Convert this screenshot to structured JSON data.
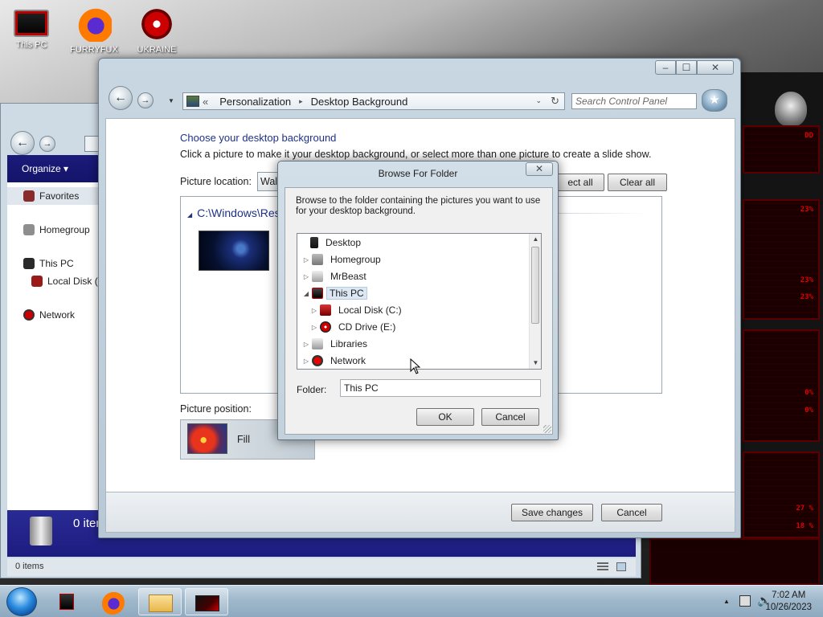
{
  "desktop_icons": [
    {
      "label": "This PC",
      "icon": "this-pc-icon"
    },
    {
      "label": "FURRYFUX",
      "icon": "firefox-icon"
    },
    {
      "label": "UKRAINE",
      "icon": "radiation-icon"
    }
  ],
  "explorer": {
    "organize_label": "Organize ▾",
    "sidebar": [
      {
        "label": "Favorites",
        "icon": "star-icon"
      },
      {
        "label": "Homegroup",
        "icon": "homegroup-icon"
      },
      {
        "label": "This PC",
        "icon": "computer-icon"
      },
      {
        "label": "Local Disk (C:",
        "icon": "disk-icon"
      },
      {
        "label": "Network",
        "icon": "network-icon"
      }
    ],
    "footer_text": "0 iten",
    "status_text": "0 items"
  },
  "control_panel": {
    "breadcrumb": [
      "Personalization",
      "Desktop Background"
    ],
    "breadcrumb_prefix": "«",
    "search_placeholder": "Search Control Panel",
    "heading": "Choose your desktop background",
    "instruction": "Click a picture to make it your desktop background, or select more than one picture to create a slide show.",
    "picture_location_label": "Picture location:",
    "picture_location_value": "Wall",
    "select_all_label": "ect all",
    "clear_all_label": "Clear all",
    "gallery_group": "C:\\Windows\\Res",
    "picture_position_label": "Picture position:",
    "picture_position_value": "Fill",
    "save_label": "Save changes",
    "cancel_label": "Cancel",
    "min_glyph": "‒",
    "max_glyph": "☐",
    "close_glyph": "✕"
  },
  "browse_dialog": {
    "title": "Browse For Folder",
    "close_glyph": "✕",
    "description": "Browse to the folder containing the pictures you want to use for your desktop background.",
    "tree": [
      {
        "label": "Desktop",
        "icon": "desktop-icon",
        "level": 0,
        "expander": "",
        "selected": false
      },
      {
        "label": "Homegroup",
        "icon": "homegroup-icon",
        "level": 1,
        "expander": "▷",
        "selected": false
      },
      {
        "label": "MrBeast",
        "icon": "user-folder-icon",
        "level": 1,
        "expander": "▷",
        "selected": false
      },
      {
        "label": "This PC",
        "icon": "computer-icon",
        "level": 1,
        "expander": "◢",
        "selected": true
      },
      {
        "label": "Local Disk (C:)",
        "icon": "disk-icon",
        "level": 2,
        "expander": "▷",
        "selected": false
      },
      {
        "label": "CD Drive (E:)",
        "icon": "cd-drive-icon",
        "level": 2,
        "expander": "▷",
        "selected": false
      },
      {
        "label": "Libraries",
        "icon": "libraries-icon",
        "level": 1,
        "expander": "▷",
        "selected": false
      },
      {
        "label": "Network",
        "icon": "network-icon",
        "level": 1,
        "expander": "▷",
        "selected": false
      }
    ],
    "folder_label": "Folder:",
    "folder_value": "This PC",
    "ok_label": "OK",
    "cancel_label": "Cancel"
  },
  "desktop_widget": {
    "readouts": [
      "DD",
      "23%",
      "23%",
      "23%",
      "0%",
      "0%",
      "27 %",
      "18 %"
    ]
  },
  "taskbar": {
    "time": "7:02 AM",
    "date": "10/26/2023"
  },
  "colors": {
    "link_blue": "#1e3287",
    "explorer_nav": "#1b1b7a",
    "widget_red": "#e00000"
  }
}
